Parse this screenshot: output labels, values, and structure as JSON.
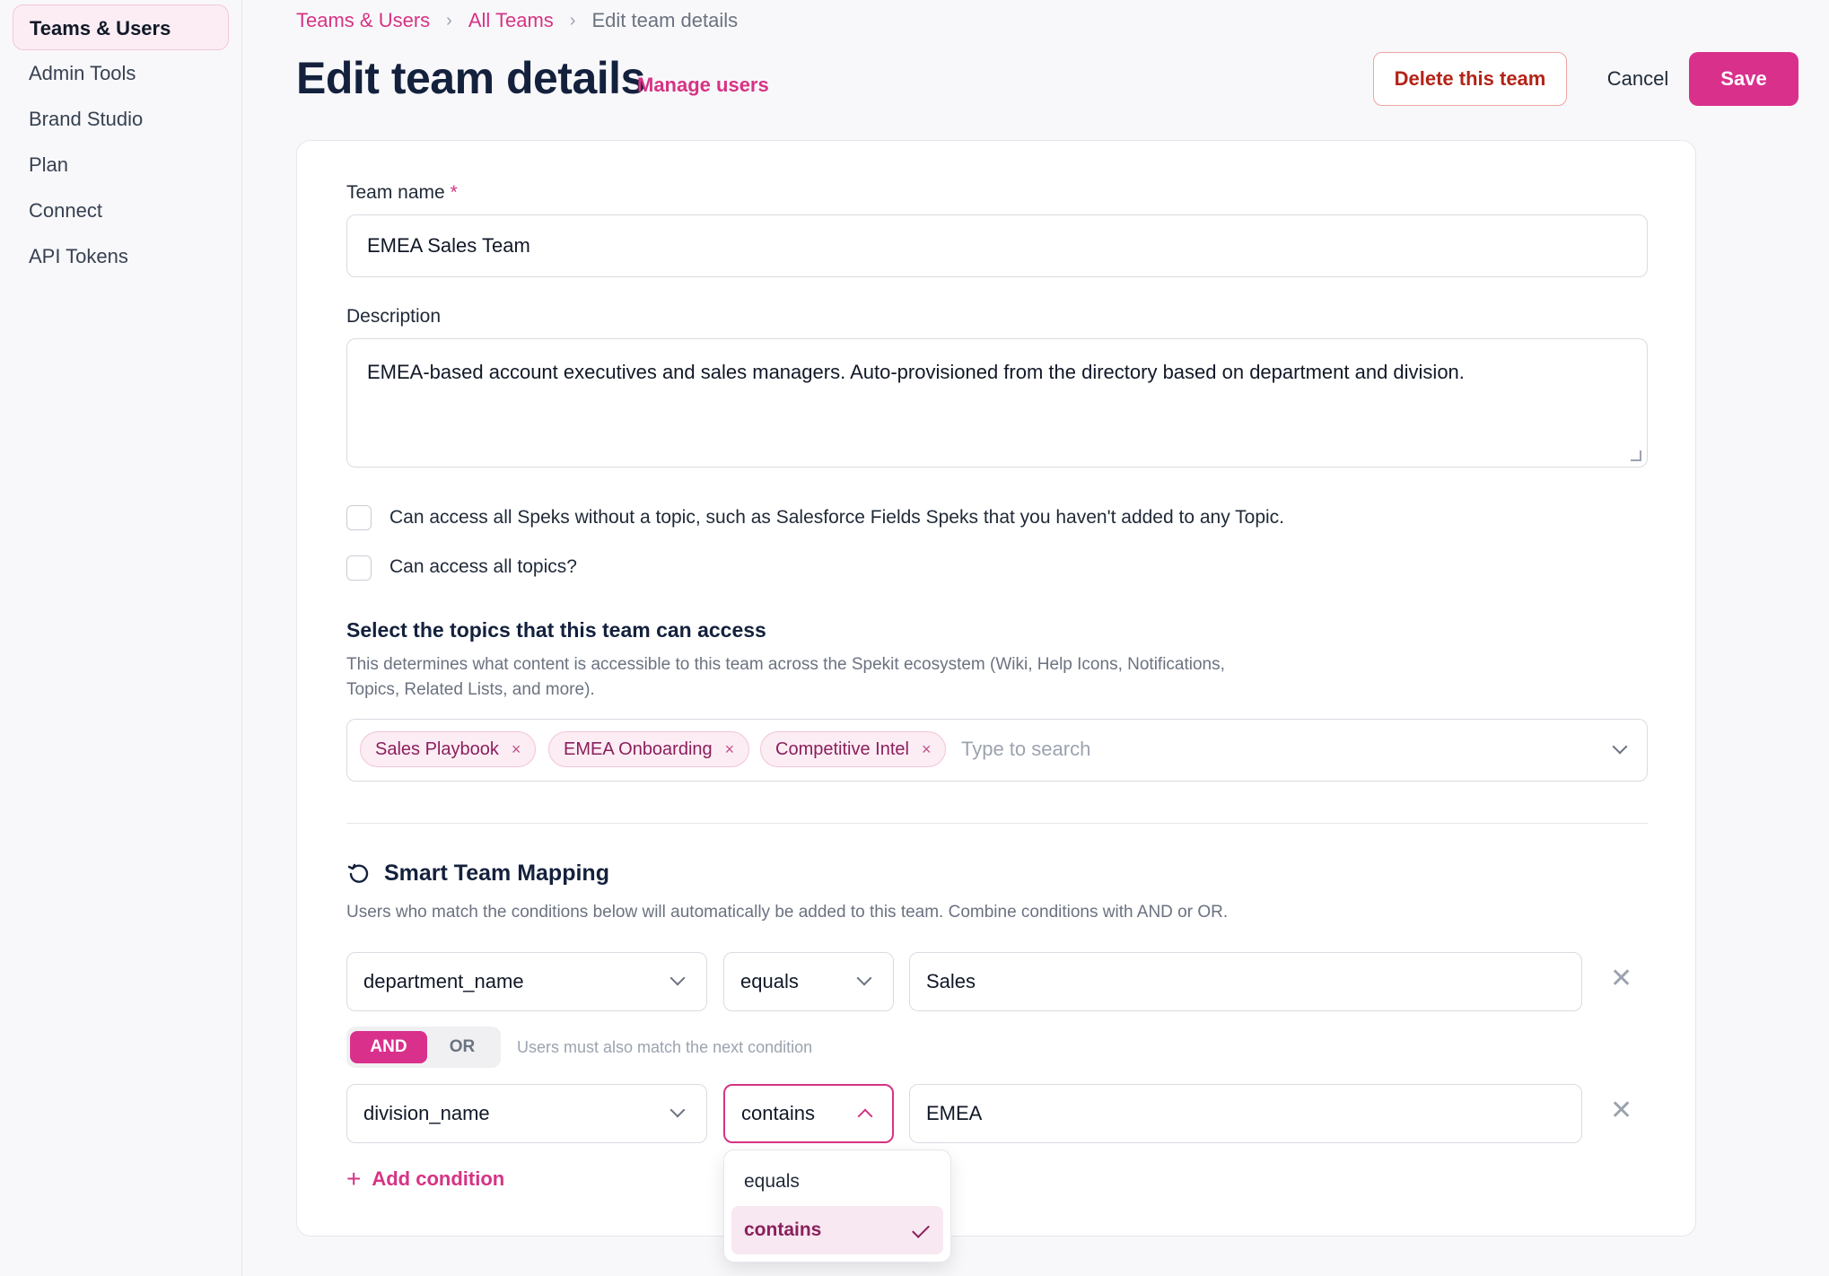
{
  "sidebar": {
    "items": [
      {
        "label": "Teams & Users",
        "active": true
      },
      {
        "label": "Admin Tools"
      },
      {
        "label": "Brand Studio"
      },
      {
        "label": "Plan"
      },
      {
        "label": "Connect"
      },
      {
        "label": "API Tokens"
      }
    ]
  },
  "breadcrumb": {
    "items": [
      "Teams & Users",
      "All Teams",
      "Edit team details"
    ],
    "separator": "›"
  },
  "header": {
    "title": "Edit team details",
    "manage_link": "Manage users",
    "delete_label": "Delete this team",
    "cancel_label": "Cancel",
    "save_label": "Save"
  },
  "form": {
    "team_name_label": "Team name",
    "required_mark": "*",
    "team_name_value": "EMEA Sales Team",
    "description_label": "Description",
    "description_value": "EMEA-based account executives and sales managers. Auto-provisioned from the directory based on department and division.",
    "checkbox_1": {
      "label": "Can access all Speks without a topic, such as Salesforce Fields Speks that you haven't added to any Topic.",
      "checked": false
    },
    "checkbox_2": {
      "label": "Can access all topics?",
      "checked": false
    },
    "topics_title": "Select the topics that this team can access",
    "topics_helper_1": "This determines what content is accessible to this team across the Spekit ecosystem (Wiki, Help Icons, Notifications,",
    "topics_helper_2": "Topics, Related Lists, and more).",
    "topics": [
      "Sales Playbook",
      "EMEA Onboarding",
      "Competitive Intel"
    ],
    "chip_remove": "×",
    "topics_placeholder": "Type to search"
  },
  "mapping": {
    "title": "Smart Team Mapping",
    "helper": "Users who match the conditions below will automatically be added to this team. Combine conditions with AND or OR.",
    "conditions": [
      {
        "field": "department_name",
        "operator": "equals",
        "value": "Sales"
      },
      {
        "field": "division_name",
        "operator": "contains",
        "value": "EMEA"
      }
    ],
    "remove_glyph": "✕",
    "logic": {
      "and_label": "AND",
      "or_label": "OR",
      "selected": "AND",
      "hint": "Users must also match the next condition"
    },
    "add_condition_icon": "+",
    "add_condition_label": "Add condition",
    "operator_menu": {
      "options": [
        "equals",
        "contains"
      ],
      "selected": "contains"
    }
  },
  "colors": {
    "accent": "#d9308c",
    "accent_text": "#d63384",
    "chip_bg": "#fcedf4",
    "title": "#14213d",
    "danger": "#b42318"
  }
}
